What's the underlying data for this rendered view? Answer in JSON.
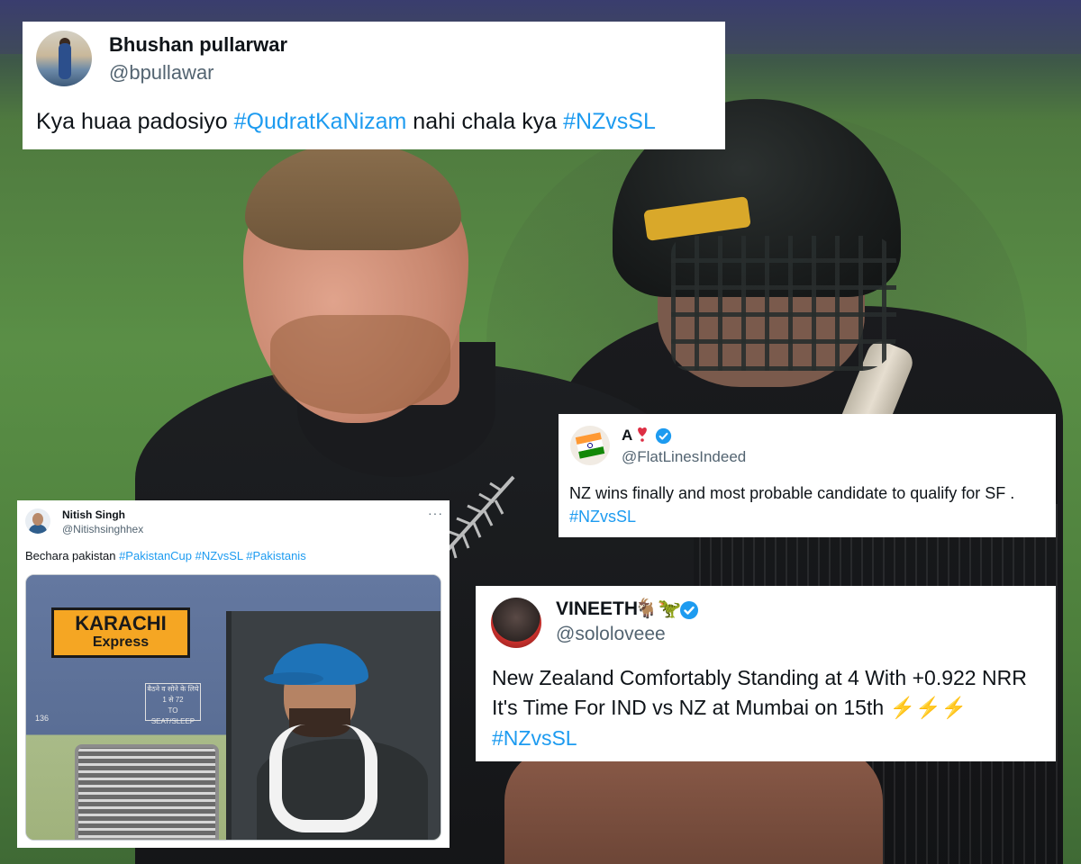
{
  "tweets": {
    "top": {
      "name": "Bhushan pullarwar",
      "handle": "@bpullawar",
      "text_plain_1": "Kya huaa padosiyo ",
      "hashtag_1": "#QudratKaNizam",
      "text_plain_2": " nahi chala kya ",
      "hashtag_2": "#NZvsSL"
    },
    "right_middle": {
      "name": "A",
      "handle": "@FlatLinesIndeed",
      "text": "NZ wins finally and most probable candidate to qualify for SF .",
      "hashtag": "#NZvsSL",
      "avatar_icon": "india-flag-icon",
      "name_emoji_icon": "red-exclamation-heart-icon",
      "verified": true
    },
    "left_media": {
      "name": "Nitish Singh",
      "handle": "@Nitishsinghhex",
      "more_label": "···",
      "text_plain": "Bechara pakistan ",
      "hashtags": "#PakistanCup #NZvsSL #Pakistanis",
      "media": {
        "sign_line_1": "KARACHI",
        "sign_line_2": "Express",
        "plate_line_1": "बैठने व सोने के लिये",
        "plate_line_2": "1 से 72",
        "plate_line_3": "TO SEAT/SLEEP",
        "coach_code": "136"
      }
    },
    "bottom_right": {
      "name": "VINEETH",
      "name_emojis": "🐐🦖",
      "handle": "@sololoveee",
      "line_1": "New Zealand Comfortably Standing at 4 With +0.922 NRR",
      "line_2": "It's Time For IND vs NZ at Mumbai on 15th ",
      "bolts": "⚡⚡⚡",
      "hashtag": "#NZvsSL",
      "verified": true
    }
  },
  "colors": {
    "link": "#1d9bf0",
    "secondary_text": "#536471",
    "primary_text": "#0f1419",
    "verified_badge": "#1d9bf0"
  }
}
